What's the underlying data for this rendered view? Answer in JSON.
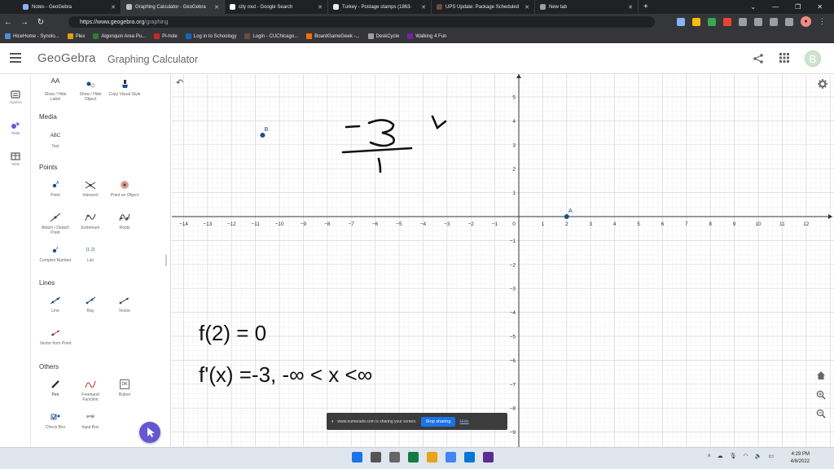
{
  "browser": {
    "tabs": [
      {
        "title": "Notes - GeoGebra",
        "active": false
      },
      {
        "title": "Graphing Calculator - GeoGebra",
        "active": true
      },
      {
        "title": "city rout - Google Search",
        "active": false
      },
      {
        "title": "Turkey - Postage stamps (1863-",
        "active": false
      },
      {
        "title": "UPS Update: Package Scheduled",
        "active": false
      },
      {
        "title": "New tab",
        "active": false
      }
    ],
    "new_tab_label": "+",
    "url_host": "https://www.geogebra.org",
    "url_path": "/graphing",
    "bookmarks": [
      {
        "label": "HiceHome - Synolo...",
        "color": "#4a90d9"
      },
      {
        "label": "Plex",
        "color": "#e5a00d"
      },
      {
        "label": "Algonquin Area Pu...",
        "color": "#2e7d32"
      },
      {
        "label": "Pi-hole",
        "color": "#c62828"
      },
      {
        "label": "Log in to Schoology",
        "color": "#1565c0"
      },
      {
        "label": "Login - CUChicago...",
        "color": "#6d4c41"
      },
      {
        "label": "BoardGameGeek -...",
        "color": "#ff6f00"
      },
      {
        "label": "DeskCycle",
        "color": "#9e9e9e"
      },
      {
        "label": "Walking 4 Fun",
        "color": "#7b1fa2"
      }
    ]
  },
  "app": {
    "logo": "GeoGebra",
    "name": "Graphing Calculator",
    "avatar_letter": "B",
    "accent": "#6557d2"
  },
  "rail": {
    "algebra": "Algebra",
    "tools": "Tools",
    "table": "Table"
  },
  "tools_panel": {
    "top_row": [
      "Show / Hide Label",
      "Show / Hide Object",
      "Copy Visual Style"
    ],
    "media_title": "Media",
    "media": [
      "Text"
    ],
    "text_icon": "ABC",
    "points_title": "Points",
    "points": [
      "Point",
      "Intersect",
      "Point on Object",
      "Attach / Detach Point",
      "Extremum",
      "Roots",
      "Complex Number",
      "List"
    ],
    "list_icon": "{1,2}",
    "lines_title": "Lines",
    "lines": [
      "Line",
      "Ray",
      "Vector",
      "Vector from Point"
    ],
    "others_title": "Others",
    "others": [
      "Pen",
      "Freehand Function",
      "Button",
      "Check Box",
      "Input Box"
    ],
    "button_icon": "OK"
  },
  "graph": {
    "x_ticks": [
      -14,
      -13,
      -12,
      -11,
      -10,
      -9,
      -8,
      -7,
      -6,
      -5,
      -4,
      -3,
      -2,
      -1,
      0,
      1,
      2,
      3,
      4,
      5,
      6,
      7,
      8,
      9,
      10,
      11,
      12
    ],
    "y_ticks": [
      5,
      4,
      3,
      2,
      1,
      -1,
      -2,
      -3,
      -4,
      -5,
      -6,
      -7,
      -8,
      -9
    ],
    "points": [
      {
        "label": "A",
        "x": 2,
        "y": 0
      },
      {
        "label": "B",
        "x": -10.7,
        "y": 3.4
      }
    ],
    "point_color": "#1f4e8c"
  },
  "annotations": {
    "line1": "f(2) = 0",
    "line2": "f'(x) =-3, -∞ < x <∞",
    "fraction_numerator": "-3",
    "fraction_denominator": "1"
  },
  "share_banner": {
    "text": "www.numerade.com is sharing your screen.",
    "stop_label": "Stop sharing",
    "hide_label": "Hide"
  },
  "taskbar": {
    "time": "4:29 PM",
    "date": "4/8/2022"
  }
}
